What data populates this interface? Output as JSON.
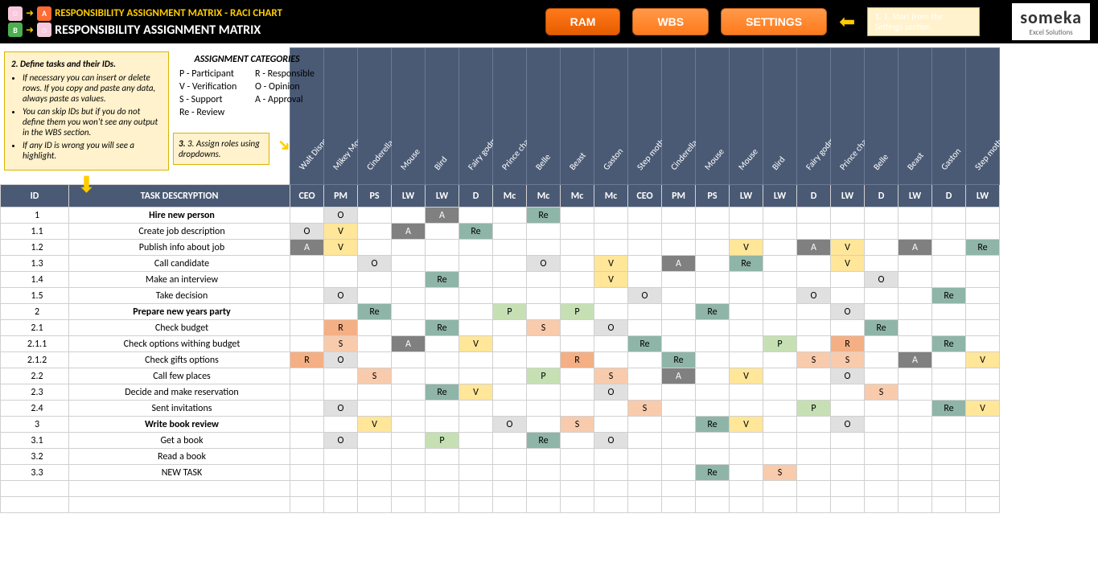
{
  "header": {
    "subtitle": "RESPONSIBILITY ASSIGNMENT MATRIX - RACI CHART",
    "title": "RESPONSIBILITY ASSIGNMENT MATRIX",
    "btn_ram": "RAM",
    "btn_wbs": "WBS",
    "btn_settings": "SETTINGS",
    "inst1": "1. Start from the Settings section.",
    "logo_main": "someka",
    "logo_sub": "Excel Solutions"
  },
  "inst2": {
    "title": "2. Define tasks and their IDs.",
    "b1": "If necessary you can insert or delete rows. If you copy and paste any data, always paste as values.",
    "b2": "You can skip IDs but if you do not define them you won't see any output in the WBS section.",
    "b3": "If any ID is wrong you will see a highlight."
  },
  "cat": {
    "title": "ASSIGNMENT CATEGORIES",
    "p": "P - Participant",
    "r": "R - Responsible",
    "v": "V - Verification",
    "o": "O - Opinion",
    "s": "S - Support",
    "a": "A - Approval",
    "re": "Re - Review"
  },
  "inst3": "3. Assign roles using dropdowns.",
  "cols": {
    "id": "ID",
    "desc": "TASK DESCRYPTION",
    "names": [
      "Walt Disney",
      "Mikey Mouse",
      "Cinderella",
      "Mouse",
      "Bird",
      "Fairy godmother",
      "Prince charming",
      "Belle",
      "Beast",
      "Gaston",
      "Step mother",
      "Cinderella",
      "Mouse",
      "Mouse",
      "Bird",
      "Fairy godmother",
      "Prince charming",
      "Belle",
      "Beast",
      "Gaston",
      "Step mother"
    ],
    "roles": [
      "CEO",
      "PM",
      "PS",
      "LW",
      "LW",
      "D",
      "Mc",
      "Mc",
      "Mc",
      "Mc",
      "CEO",
      "PM",
      "PS",
      "LW",
      "LW",
      "D",
      "LW",
      "D",
      "LW",
      "D",
      "LW"
    ]
  },
  "rows": [
    {
      "id": "1",
      "desc": "Hire new person",
      "bold": true,
      "v": [
        "",
        "O",
        "",
        "",
        "A",
        "",
        "",
        "Re",
        "",
        "",
        "",
        "",
        "",
        "",
        "",
        "",
        "",
        "",
        "",
        "",
        ""
      ]
    },
    {
      "id": "1.1",
      "desc": "Create job description",
      "v": [
        "O",
        "V",
        "",
        "A",
        "",
        "Re",
        "",
        "",
        "",
        "",
        "",
        "",
        "",
        "",
        "",
        "",
        "",
        "",
        "",
        "",
        ""
      ]
    },
    {
      "id": "1.2",
      "desc": "Publish info about job",
      "v": [
        "A",
        "V",
        "",
        "",
        "",
        "",
        "",
        "",
        "",
        "",
        "",
        "",
        "",
        "V",
        "",
        "A",
        "V",
        "",
        "A",
        "",
        "Re"
      ]
    },
    {
      "id": "1.3",
      "desc": "Call candidate",
      "v": [
        "",
        "",
        "O",
        "",
        "",
        "",
        "",
        "O",
        "",
        "V",
        "",
        "A",
        "",
        "Re",
        "",
        "",
        "V",
        "",
        "",
        "",
        ""
      ]
    },
    {
      "id": "1.4",
      "desc": "Make an interview",
      "v": [
        "",
        "",
        "",
        "",
        "Re",
        "",
        "",
        "",
        "",
        "V",
        "",
        "",
        "",
        "",
        "",
        "",
        "",
        "O",
        "",
        "",
        ""
      ]
    },
    {
      "id": "1.5",
      "desc": "Take decision",
      "v": [
        "",
        "O",
        "",
        "",
        "",
        "",
        "",
        "",
        "",
        "",
        "O",
        "",
        "",
        "",
        "",
        "O",
        "",
        "",
        "",
        "Re",
        ""
      ]
    },
    {
      "id": "2",
      "desc": "Prepare new years party",
      "bold": true,
      "v": [
        "",
        "",
        "Re",
        "",
        "",
        "",
        "P",
        "",
        "P",
        "",
        "",
        "",
        "Re",
        "",
        "",
        "",
        "O",
        "",
        "",
        "",
        ""
      ]
    },
    {
      "id": "2.1",
      "desc": "Check budget",
      "v": [
        "",
        "R",
        "",
        "",
        "Re",
        "",
        "",
        "S",
        "",
        "O",
        "",
        "",
        "",
        "",
        "",
        "",
        "",
        "Re",
        "",
        "",
        ""
      ]
    },
    {
      "id": "2.1.1",
      "desc": "Check options withing budget",
      "v": [
        "",
        "S",
        "",
        "A",
        "",
        "V",
        "",
        "",
        "",
        "",
        "Re",
        "",
        "",
        "",
        "P",
        "",
        "R",
        "",
        "",
        "Re",
        ""
      ]
    },
    {
      "id": "2.1.2",
      "desc": "Check gifts options",
      "v": [
        "R",
        "O",
        "",
        "",
        "",
        "",
        "",
        "",
        "R",
        "",
        "",
        "Re",
        "",
        "",
        "",
        "S",
        "S",
        "",
        "A",
        "",
        "V"
      ]
    },
    {
      "id": "2.2",
      "desc": "Call few places",
      "v": [
        "",
        "",
        "S",
        "",
        "",
        "",
        "",
        "P",
        "",
        "S",
        "",
        "A",
        "",
        "V",
        "",
        "",
        "O",
        "",
        "",
        "",
        ""
      ]
    },
    {
      "id": "2.3",
      "desc": "Decide and make reservation",
      "v": [
        "",
        "",
        "",
        "",
        "Re",
        "V",
        "",
        "",
        "",
        "O",
        "",
        "",
        "",
        "",
        "",
        "",
        "",
        "S",
        "",
        "",
        ""
      ]
    },
    {
      "id": "2.4",
      "desc": "Sent invitations",
      "v": [
        "",
        "O",
        "",
        "",
        "",
        "",
        "",
        "",
        "",
        "",
        "S",
        "",
        "",
        "",
        "",
        "P",
        "",
        "",
        "",
        "Re",
        "V"
      ]
    },
    {
      "id": "3",
      "desc": "Write book review",
      "bold": true,
      "v": [
        "",
        "",
        "V",
        "",
        "",
        "",
        "O",
        "",
        "S",
        "",
        "",
        "",
        "Re",
        "V",
        "",
        "",
        "O",
        "",
        "",
        "",
        ""
      ]
    },
    {
      "id": "3.1",
      "desc": "Get a book",
      "v": [
        "",
        "O",
        "",
        "",
        "P",
        "",
        "",
        "Re",
        "",
        "O",
        "",
        "",
        "",
        "",
        "",
        "",
        "",
        "",
        "",
        "",
        ""
      ]
    },
    {
      "id": "3.2",
      "desc": "Read a book",
      "v": [
        "",
        "",
        "",
        "",
        "",
        "",
        "",
        "",
        "",
        "",
        "",
        "",
        "",
        "",
        "",
        "",
        "",
        "",
        "",
        "",
        ""
      ]
    },
    {
      "id": "3.3",
      "desc": "NEW TASK",
      "v": [
        "",
        "",
        "",
        "",
        "",
        "",
        "",
        "",
        "",
        "",
        "",
        "",
        "Re",
        "",
        "S",
        "",
        "",
        "",
        "",
        "",
        ""
      ]
    },
    {
      "id": "",
      "desc": "",
      "v": [
        "",
        "",
        "",
        "",
        "",
        "",
        "",
        "",
        "",
        "",
        "",
        "",
        "",
        "",
        "",
        "",
        "",
        "",
        "",
        "",
        ""
      ]
    },
    {
      "id": "",
      "desc": "",
      "v": [
        "",
        "",
        "",
        "",
        "",
        "",
        "",
        "",
        "",
        "",
        "",
        "",
        "",
        "",
        "",
        "",
        "",
        "",
        "",
        "",
        ""
      ]
    }
  ]
}
